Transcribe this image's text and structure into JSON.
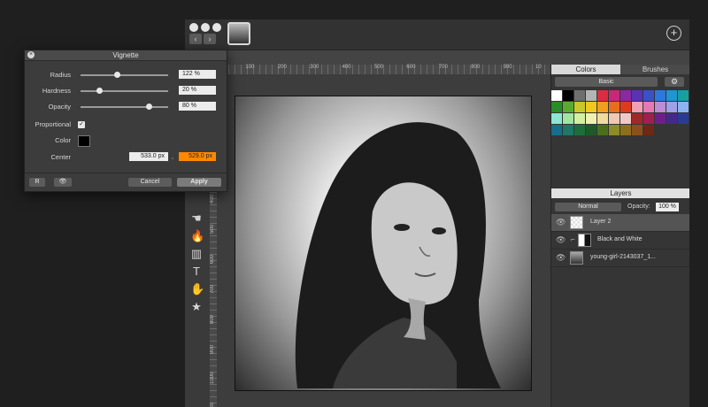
{
  "window": {
    "thumbnail_icon": "photo-thumbnail",
    "add_icon": "plus-circle-icon",
    "nav": {
      "back": "‹",
      "forward": "›"
    }
  },
  "ruler": {
    "h": [
      "0",
      "100",
      "200",
      "300",
      "400",
      "500",
      "600",
      "700",
      "800",
      "900",
      "10"
    ],
    "v": [
      "100",
      "200",
      "300",
      "400",
      "500",
      "600",
      "700",
      "800",
      "900",
      "1000",
      "1100"
    ]
  },
  "tools": [
    {
      "name": "smudge-tool",
      "icon": "smudge-icon",
      "glyph": "☚"
    },
    {
      "name": "burn-tool",
      "icon": "flame-icon",
      "glyph": "🔥"
    },
    {
      "name": "gradient-tool",
      "icon": "gradient-icon",
      "glyph": "▥"
    },
    {
      "name": "text-tool",
      "icon": "text-icon",
      "glyph": "T"
    },
    {
      "name": "hand-tool",
      "icon": "hand-icon",
      "glyph": "✋"
    },
    {
      "name": "favorites-tool",
      "icon": "star-icon",
      "glyph": "★"
    }
  ],
  "vignette": {
    "title": "Vignette",
    "radius_label": "Radius",
    "radius_value": "122 %",
    "radius_level": 0.42,
    "hardness_label": "Hardness",
    "hardness_value": "20 %",
    "hardness_level": 0.22,
    "opacity_label": "Opacity",
    "opacity_value": "80 %",
    "opacity_level": 0.78,
    "proportional_label": "Proportional",
    "proportional_checked": true,
    "color_label": "Color",
    "color_value": "#000000",
    "center_label": "Center",
    "center_x": "533.0 px",
    "center_sep": ",",
    "center_y": "529.0 px",
    "reset_label": "R",
    "preview_icon": "eye-icon",
    "cancel_label": "Cancel",
    "apply_label": "Apply"
  },
  "colors_panel": {
    "tab_colors": "Colors",
    "tab_brushes": "Brushes",
    "palette": "Basic",
    "gear_icon": "gear-icon",
    "swatches": [
      "#ffffff",
      "#000000",
      "#6e6e6e",
      "#b4b4b4",
      "#dc2c44",
      "#c82878",
      "#8c28a0",
      "#5a32b4",
      "#3c50c8",
      "#2d78dc",
      "#1e96d2",
      "#18a0a0",
      "#1ea05a",
      "#288c28",
      "#5aaa32",
      "#c8c828",
      "#f0c81e",
      "#f0a01e",
      "#e66e1e",
      "#dc3c1e",
      "#f0a0b4",
      "#e678b4",
      "#be8cd2",
      "#a0a0e6",
      "#8cb4f0",
      "#8cd2f0",
      "#8ce6d2",
      "#a0e6a0",
      "#d2f0a0",
      "#f0f0b4",
      "#f0dca0",
      "#f0c8b4",
      "#f0c8c8",
      "#a02828",
      "#a01e50",
      "#6e1e8c",
      "#46288c",
      "#283c96",
      "#1e5aa0",
      "#146e8c",
      "#1e7864",
      "#1e6e3c",
      "#1e5a28",
      "#4b6e1e",
      "#8c8c28",
      "#8c6e1e",
      "#8c501e",
      "#6e2814"
    ]
  },
  "layers_panel": {
    "title": "Layers",
    "blend_mode": "Normal",
    "opacity_label": "Opacity:",
    "opacity_value": "100 %",
    "layers": [
      {
        "name": "Layer 2",
        "visible": true,
        "selected": true
      },
      {
        "name": "Black and White",
        "visible": true,
        "selected": false
      },
      {
        "name": "young-girl-2143037_1...",
        "visible": true,
        "selected": false
      }
    ]
  }
}
